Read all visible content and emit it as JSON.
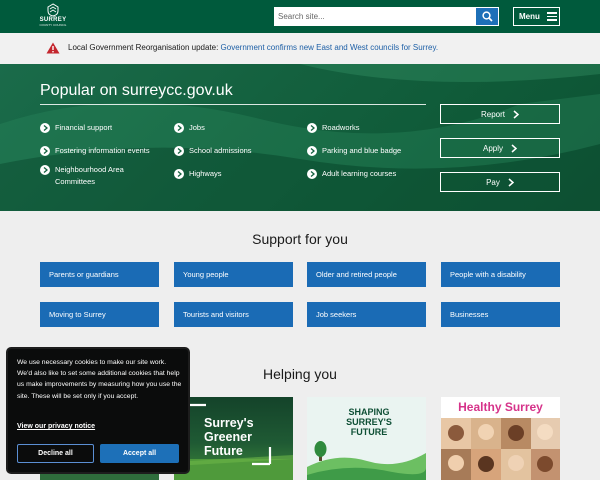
{
  "header": {
    "logo": {
      "name": "SURREY",
      "sub": "COUNTY COUNCIL"
    },
    "search_placeholder": "Search site...",
    "menu_label": "Menu"
  },
  "alert": {
    "text": "Local Government Reorganisation update: ",
    "link": "Government confirms new East and West councils for Surrey."
  },
  "hero": {
    "title": "Popular on surreycc.gov.uk",
    "links": [
      "Financial support",
      "Jobs",
      "Roadworks",
      "Fostering information events",
      "School admissions",
      "Parking and blue badge",
      "Neighbourhood Area Committees",
      "Highways",
      "Adult learning courses"
    ],
    "actions": [
      "Report",
      "Apply",
      "Pay"
    ]
  },
  "support": {
    "title": "Support for you",
    "tiles": [
      "Parents or guardians",
      "Young people",
      "Older and retired people",
      "People with a disability",
      "Moving to Surrey",
      "Tourists and visitors",
      "Job seekers",
      "Businesses"
    ]
  },
  "helping": {
    "title": "Helping you",
    "cards": [
      {
        "title": "Surrey's Greener Future"
      },
      {
        "title": "SHAPING SURREY'S FUTURE"
      },
      {
        "title": "Healthy Surrey"
      }
    ]
  },
  "cookie": {
    "text": "We use necessary cookies to make our site work. We'd also like to set some additional cookies that help us make improvements by measuring how you use the site. These will be set only if you accept.",
    "link": "View our privacy notice",
    "decline": "Decline all",
    "accept": "Accept all"
  },
  "colors": {
    "brand_green": "#005a3c",
    "tile_blue": "#1a6bb5",
    "link_blue": "#1d5fa6",
    "warning_red": "#c4262e"
  }
}
